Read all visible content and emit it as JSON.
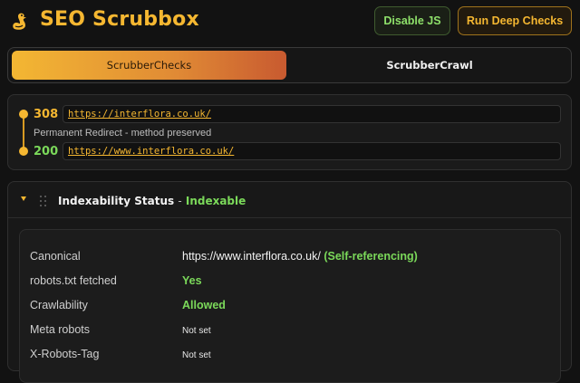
{
  "header": {
    "title": "SEO Scrubbox",
    "disable_js_label": "Disable JS",
    "deep_checks_label": "Run Deep Checks"
  },
  "tabs": [
    {
      "label": "ScrubberChecks",
      "active": true
    },
    {
      "label": "ScrubberCrawl",
      "active": false
    }
  ],
  "redirect_chain": {
    "hops": [
      {
        "code": "308",
        "url": "https://interflora.co.uk/",
        "code_color": "#f5b731"
      },
      {
        "code": "200",
        "url": "https://www.interflora.co.uk/",
        "code_color": "#7bd95a"
      }
    ],
    "note": "Permanent Redirect - method preserved"
  },
  "indexability": {
    "title": "Indexability Status",
    "separator": "-",
    "status": "Indexable",
    "rows": [
      {
        "label": "Canonical",
        "value": "https://www.interflora.co.uk/",
        "extra": "(Self-referencing)"
      },
      {
        "label": "robots.txt fetched",
        "value": "Yes"
      },
      {
        "label": "Crawlability",
        "value": "Allowed"
      },
      {
        "label": "Meta robots",
        "value": "Not set"
      },
      {
        "label": "X-Robots-Tag",
        "value": "Not set"
      }
    ]
  },
  "colors": {
    "accent": "#f5b731",
    "success": "#7bd95a",
    "background": "#121212"
  },
  "icons": {
    "logo": "duck-logo-icon",
    "collapse": "caret-down-icon",
    "drag": "drag-grip-icon"
  }
}
